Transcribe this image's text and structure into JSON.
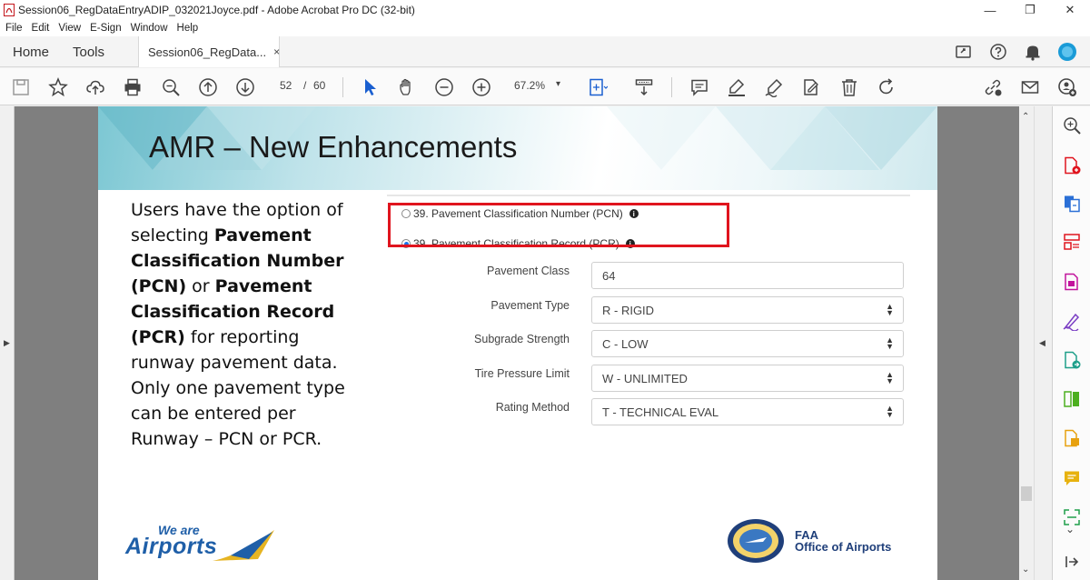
{
  "window": {
    "title": "Session06_RegDataEntryADIP_032021Joyce.pdf - Adobe Acrobat Pro DC (32-bit)",
    "controls": [
      "—",
      "❐",
      "✕"
    ]
  },
  "menu": [
    "File",
    "Edit",
    "View",
    "E-Sign",
    "Window",
    "Help"
  ],
  "tabs": {
    "home": "Home",
    "tools": "Tools",
    "document": "Session06_RegData...",
    "close": "×"
  },
  "toolbar": {
    "page_current": "52",
    "page_sep": "/",
    "page_total": "60",
    "zoom": "67.2%",
    "zoom_caret": "▾"
  },
  "slide": {
    "title": "AMR – New Enhancements",
    "body_parts": [
      {
        "t": "Users have the option of selecting ",
        "b": false
      },
      {
        "t": "Pavement Classification Number (PCN)",
        "b": true
      },
      {
        "t": " or ",
        "b": false
      },
      {
        "t": "Pavement Classification Record (PCR)",
        "b": true
      },
      {
        "t": " for reporting runway pavement data. Only one pavement type can be entered per Runway – PCN or PCR.",
        "b": false
      }
    ],
    "radio_pcn": "39. Pavement Classification Number (PCN)",
    "radio_pcr": "39. Pavement Classification Record (PCR)",
    "info": "i",
    "fields": {
      "pavement_class_label": "Pavement Class",
      "pavement_class_value": "64",
      "pavement_type_label": "Pavement Type",
      "pavement_type_value": "R - RIGID",
      "subgrade_label": "Subgrade Strength",
      "subgrade_value": "C - LOW",
      "tire_label": "Tire Pressure Limit",
      "tire_value": "W - UNLIMITED",
      "rating_label": "Rating Method",
      "rating_value": "T - TECHNICAL EVAL"
    },
    "logo_left_top": "We are",
    "logo_left_main": "Airports",
    "faa_line1": "FAA",
    "faa_line2": "Office of Airports"
  },
  "colors": {
    "red_highlight": "#e0141e",
    "faa_blue": "#1f3f7a",
    "airports_blue": "#1f5fa8",
    "acrobat_accent": "#1a73e8"
  }
}
